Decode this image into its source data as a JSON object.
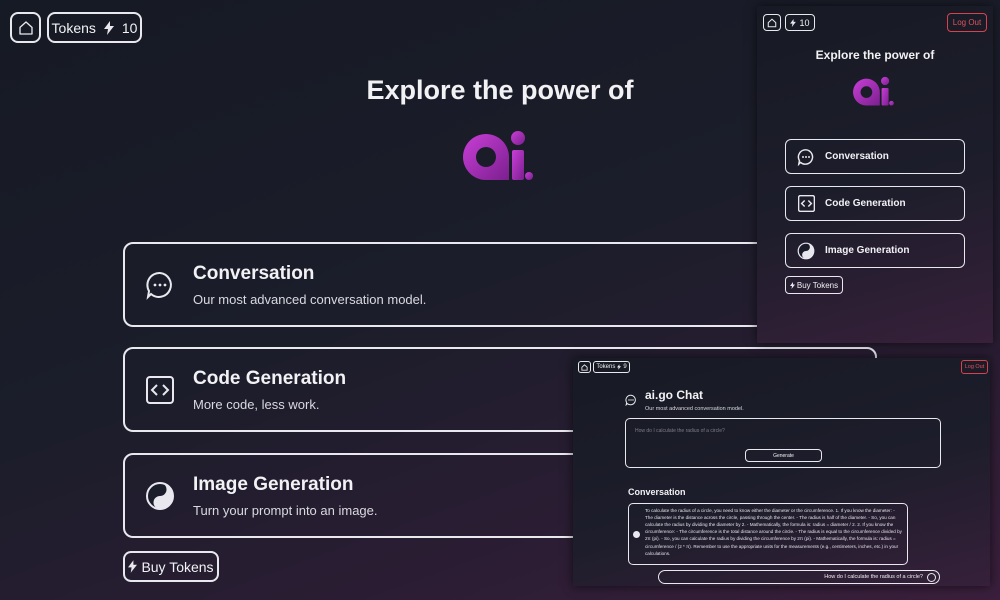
{
  "header": {
    "tokens_label": "Tokens",
    "tokens_count": "10"
  },
  "main": {
    "title": "Explore the power of",
    "logo_text": "ai.",
    "cards": [
      {
        "title": "Conversation",
        "description": "Our most advanced conversation model.",
        "icon": "chat-bubble-icon"
      },
      {
        "title": "Code Generation",
        "description": "More code, less work.",
        "icon": "code-brackets-icon"
      },
      {
        "title": "Image Generation",
        "description": "Turn your prompt into an image.",
        "icon": "yin-yang-icon"
      }
    ],
    "buy_tokens_label": "Buy Tokens"
  },
  "mobile_view": {
    "tokens_count": "10",
    "logout_label": "Log Out",
    "title": "Explore the power of",
    "cards": [
      "Conversation",
      "Code Generation",
      "Image Generation"
    ],
    "buy_tokens_label": "Buy Tokens"
  },
  "chat_view": {
    "tokens_label": "Tokens",
    "tokens_count": "9",
    "logout_label": "Log Out",
    "title": "ai.go Chat",
    "subtitle": "Our most advanced conversation model.",
    "prompt_placeholder": "How do I calculate the radius of a circle?",
    "generate_label": "Generate",
    "conversation_heading": "Conversation",
    "answer": "To calculate the radius of a circle, you need to know either the diameter or the circumference. 1. If you know the diameter: - The diameter is the distance across the circle, passing through the center. - The radius is half of the diameter. - So, you can calculate the radius by dividing the diameter by 2. - Mathematically, the formula is: radius = diameter / 2. 2. If you know the circumference: - The circumference is the total distance around the circle. - The radius is equal to the circumference divided by 2π (pi). - So, you can calculate the radius by dividing the circumference by 2π (pi). - Mathematically, the formula is: radius = circumference / (2 * π). Remember to use the appropriate units for the measurements (e.g., centimeters, inches, etc.) in your calculations.",
    "user_question": "How do I calculate the radius of a circle?"
  },
  "colors": {
    "accent_logo": "#b32bc4",
    "logout": "#d8424f"
  }
}
